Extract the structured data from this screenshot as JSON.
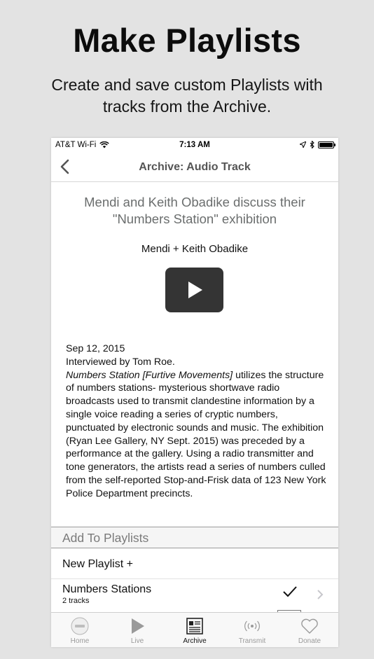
{
  "promo": {
    "title": "Make Playlists",
    "subtitle": "Create and save custom Playlists with tracks from the Archive."
  },
  "status_bar": {
    "carrier": "AT&T Wi-Fi",
    "time": "7:13 AM"
  },
  "nav": {
    "title": "Archive: Audio Track"
  },
  "track": {
    "title": "Mendi and Keith Obadike discuss their \"Numbers Station\" exhibition",
    "artist": "Mendi + Keith Obadike",
    "date": "Sep 12, 2015",
    "interviewer": "Interviewed by Tom Roe.",
    "description_italic": "Numbers Station [Furtive Movements]",
    "description_rest": " utilizes the structure of numbers stations- mysterious shortwave radio broadcasts used to transmit clandestine information by a single voice reading a series of cryptic numbers, punctuated by electronic sounds and music. The exhibition (Ryan Lee Gallery, NY Sept. 2015) was preceded by a performance at the gallery. Using a radio transmitter and tone generators, the artists read a series of numbers culled from the self-reported Stop-and-Frisk data of 123 New York Police Department precincts."
  },
  "playlists": {
    "header": "Add To Playlists",
    "new_label": "New Playlist +",
    "items": [
      {
        "name": "Numbers Stations",
        "count": "2 tracks",
        "checked": true
      }
    ]
  },
  "tabs": [
    {
      "label": "Home",
      "icon": "home-logo-icon",
      "active": false
    },
    {
      "label": "Live",
      "icon": "play-icon",
      "active": false
    },
    {
      "label": "Archive",
      "icon": "archive-icon",
      "active": true
    },
    {
      "label": "Transmit",
      "icon": "broadcast-icon",
      "active": false
    },
    {
      "label": "Donate",
      "icon": "heart-icon",
      "active": false
    }
  ],
  "colors": {
    "background": "#e3e3e3",
    "play_button": "#343434",
    "inactive_tab": "#9a9a9a"
  }
}
